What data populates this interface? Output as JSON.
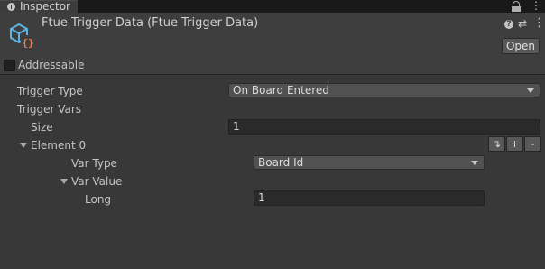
{
  "tab": {
    "label": "Inspector",
    "icon": "info-icon",
    "lock_icon": "lock-icon",
    "menu_icon": "kebab-menu-icon",
    "menu_glyph": "⋮"
  },
  "header": {
    "title": "Ftue Trigger Data (Ftue Trigger Data)",
    "asset_icon": "scriptable-object-icon",
    "help_glyph": "?",
    "preset_glyph": "⇄",
    "more_glyph": "⋮",
    "open_label": "Open"
  },
  "addressable": {
    "label": "Addressable",
    "checked": false
  },
  "fields": {
    "trigger_type_label": "Trigger Type",
    "trigger_type_value": "On Board Entered",
    "trigger_vars_label": "Trigger Vars",
    "size_label": "Size",
    "size_value": "1",
    "element0_label": "Element 0",
    "var_type_label": "Var Type",
    "var_type_value": "Board Id",
    "var_value_label": "Var Value",
    "long_label": "Long",
    "long_value": "1"
  },
  "element_buttons": {
    "move_glyph": "↴",
    "add_glyph": "+",
    "remove_glyph": "-"
  },
  "colors": {
    "background": "#383838",
    "tabbar": "#191919",
    "field_dark": "#2a2a2a",
    "dropdown": "#515151",
    "icon_blue": "#5fb3e0",
    "icon_orange": "#e8744a"
  }
}
